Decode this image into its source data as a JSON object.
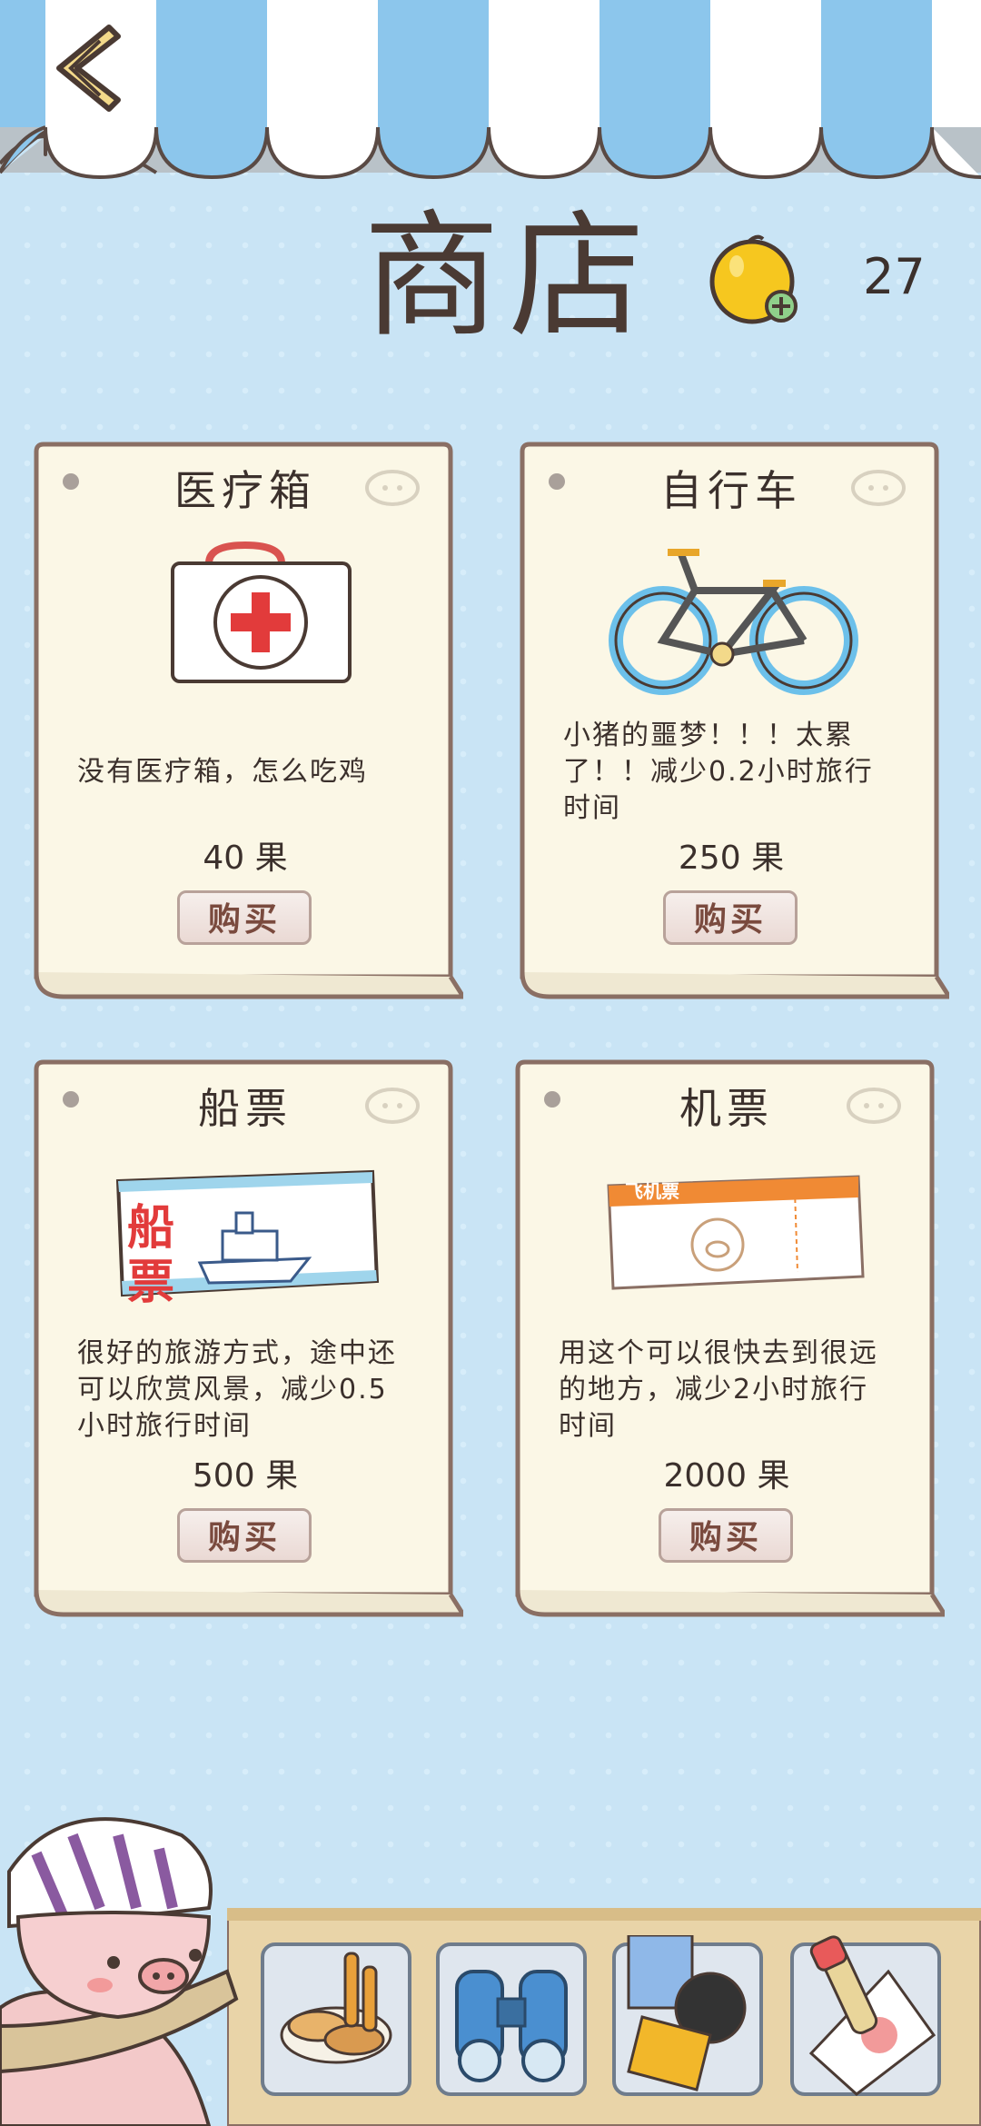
{
  "header": {
    "title": "商店",
    "coin_count": "27"
  },
  "shop_items": [
    {
      "title": "医疗箱",
      "icon": "medical-kit-icon",
      "description": "没有医疗箱，怎么吃鸡",
      "price": "40 果",
      "buy_label": "购买"
    },
    {
      "title": "自行车",
      "icon": "bicycle-icon",
      "description": "小猪的噩梦！！！太累了！！减少0.2小时旅行时间",
      "price": "250 果",
      "buy_label": "购买"
    },
    {
      "title": "船票",
      "icon": "boat-ticket-icon",
      "description": "很好的旅游方式，途中还可以欣赏风景，减少0.5小时旅行时间",
      "price": "500 果",
      "buy_label": "购买",
      "illustration_text": "船 票"
    },
    {
      "title": "机票",
      "icon": "plane-ticket-icon",
      "description": "用这个可以很快去到很远的地方，减少2小时旅行时间",
      "price": "2000 果",
      "buy_label": "购买",
      "illustration_text": "飞机票"
    }
  ],
  "inventory": [
    {
      "icon": "bread-food-icon"
    },
    {
      "icon": "binoculars-icon"
    },
    {
      "icon": "book-camera-icon"
    },
    {
      "icon": "paint-brush-icon"
    }
  ],
  "colors": {
    "background": "#c9e4f5",
    "awning_blue": "#8cc6ec",
    "card_paper": "#fbf7e6",
    "card_border": "#8a6f64",
    "coin": "#f6c71f",
    "text": "#3b302c"
  }
}
